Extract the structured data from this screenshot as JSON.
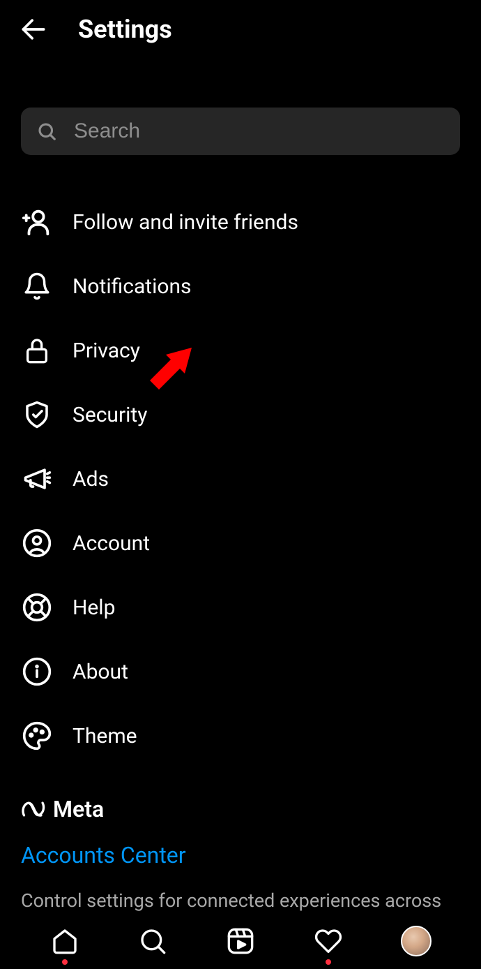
{
  "header": {
    "title": "Settings"
  },
  "search": {
    "placeholder": "Search"
  },
  "menu": {
    "items": [
      {
        "label": "Follow and invite friends"
      },
      {
        "label": "Notifications"
      },
      {
        "label": "Privacy"
      },
      {
        "label": "Security"
      },
      {
        "label": "Ads"
      },
      {
        "label": "Account"
      },
      {
        "label": "Help"
      },
      {
        "label": "About"
      },
      {
        "label": "Theme"
      }
    ]
  },
  "meta": {
    "brand": "Meta",
    "accounts_link": "Accounts Center",
    "description": "Control settings for connected experiences across Instagram, the Facebook app and Messenger,"
  }
}
